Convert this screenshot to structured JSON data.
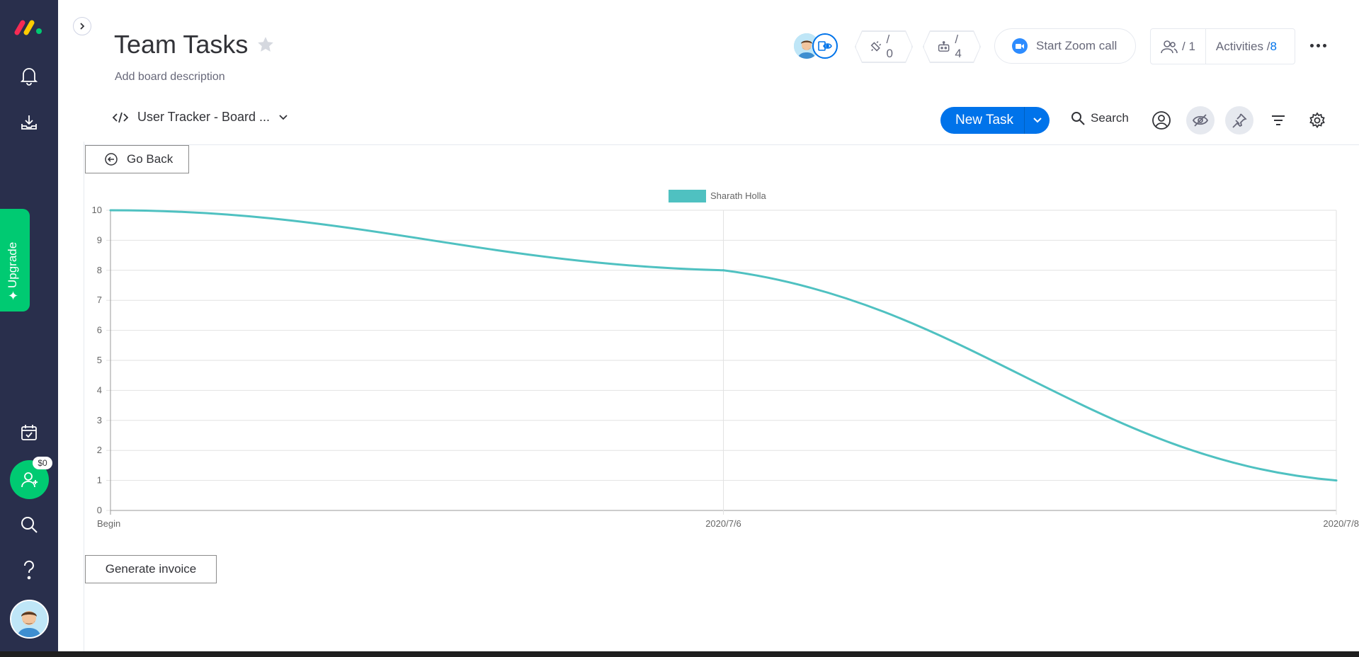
{
  "header": {
    "title": "Team Tasks",
    "description": "Add board description",
    "integrations_count": "/ 0",
    "automations_count": "/ 4",
    "zoom_label": "Start Zoom call",
    "members_count": "/ 1",
    "activities_label": "Activities /",
    "activities_count": "8"
  },
  "toolbar": {
    "view_name": "User Tracker - Board ...",
    "new_task": "New Task",
    "search": "Search"
  },
  "sidebar": {
    "upgrade_label": "Upgrade",
    "invite_badge": "$0"
  },
  "buttons": {
    "go_back": "Go Back",
    "generate_invoice": "Generate invoice"
  },
  "colors": {
    "series": "#4fc1c1",
    "accent": "#0073ea",
    "green": "#00ca72",
    "rail": "#292f4c"
  },
  "chart_data": {
    "type": "line",
    "categories": [
      "Begin",
      "2020/7/6",
      "2020/7/8"
    ],
    "series": [
      {
        "name": "Sharath Holla",
        "values": [
          10,
          8,
          1
        ]
      }
    ],
    "ylim": [
      0,
      10
    ],
    "yticks": [
      0,
      1,
      2,
      3,
      4,
      5,
      6,
      7,
      8,
      9,
      10
    ],
    "legend": "top-center",
    "grid": true
  }
}
